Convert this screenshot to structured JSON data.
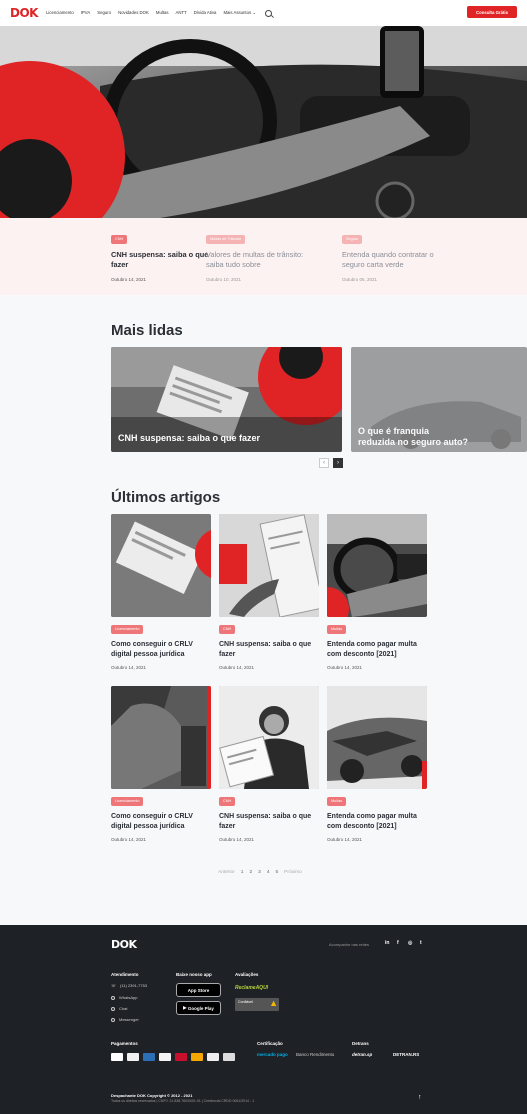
{
  "brand": {
    "logo": "DOK",
    "accent": "#e02426",
    "cta": "Consulta Grátis"
  },
  "nav": {
    "items": [
      "Licenciamento",
      "IPVA",
      "Seguro",
      "Novidades DOK",
      "Multas",
      "ANTT",
      "Dívida Ativa",
      "Mais Assuntos"
    ]
  },
  "hero_cards": [
    {
      "tag": "CNH",
      "title": "CNH suspensa: saiba o que fazer",
      "date": "Outubro 14, 2021"
    },
    {
      "tag": "Multas de Trânsito",
      "title": "Valores de multas de trânsito: saiba tudo sobre",
      "date": "Outubro 10, 2021"
    },
    {
      "tag": "Seguro",
      "title": "Entenda quando contratar o seguro carta verde",
      "date": "Outubro 05, 2021"
    }
  ],
  "mais_lidas": {
    "heading": "Mais lidas",
    "cards": [
      {
        "caption": "CNH suspensa: saiba o que fazer"
      },
      {
        "caption": "O que é franquia reduzida no seguro auto?"
      }
    ]
  },
  "ultimos": {
    "heading": "Últimos artigos",
    "articles": [
      {
        "tag": "Licenciamento",
        "title": "Como conseguir o CRLV digital pessoa jurídica",
        "date": "Outubro 14, 2021"
      },
      {
        "tag": "CNH",
        "title": "CNH suspensa: saiba o que fazer",
        "date": "Outubro 14, 2021"
      },
      {
        "tag": "Multas",
        "title": "Entenda como pagar multa com desconto [2021]",
        "date": "Outubro 14, 2021"
      },
      {
        "tag": "Licenciamento",
        "title": "Como conseguir o CRLV digital pessoa jurídica",
        "date": "Outubro 14, 2021"
      },
      {
        "tag": "CNH",
        "title": "CNH suspensa: saiba o que fazer",
        "date": "Outubro 14, 2021"
      },
      {
        "tag": "Multas",
        "title": "Entenda como pagar multa com desconto [2021]",
        "date": "Outubro 14, 2021"
      }
    ]
  },
  "pagination": {
    "prev": "Anterior",
    "pages": [
      "1",
      "2",
      "3",
      "4",
      "5"
    ],
    "next": "Próximo"
  },
  "footer": {
    "logo": "DOK",
    "follow": "Acompanhe nas redes",
    "social": [
      "in",
      "f",
      "◎",
      "t"
    ],
    "atendimento": {
      "heading": "Atendimento",
      "items": [
        "(11) 2391-7753",
        "WhatsApp",
        "Chat",
        "Messenger"
      ]
    },
    "app": {
      "heading": "Baixe nosso app",
      "apple": "App Store",
      "google": "Google Play"
    },
    "avaliacoes": {
      "heading": "Avaliações",
      "reclame": "ReclameAQUI",
      "affiliate": "Confiável"
    },
    "pagamentos": {
      "heading": "Pagamentos"
    },
    "certificacao": {
      "heading": "Certificação",
      "items": [
        "mercado pago",
        "Banco Rendimento"
      ]
    },
    "detran": {
      "heading": "Detrans",
      "items": [
        "detran.sp",
        "DETRAN.RS"
      ]
    },
    "copyright": "Despachante DOK Copyright © 2012 - 2021",
    "legal": "Todos os direitos reservados | CNPJ: 21.838.760/0001-91 | Credencial CRDD 0061/2014 - 1"
  }
}
